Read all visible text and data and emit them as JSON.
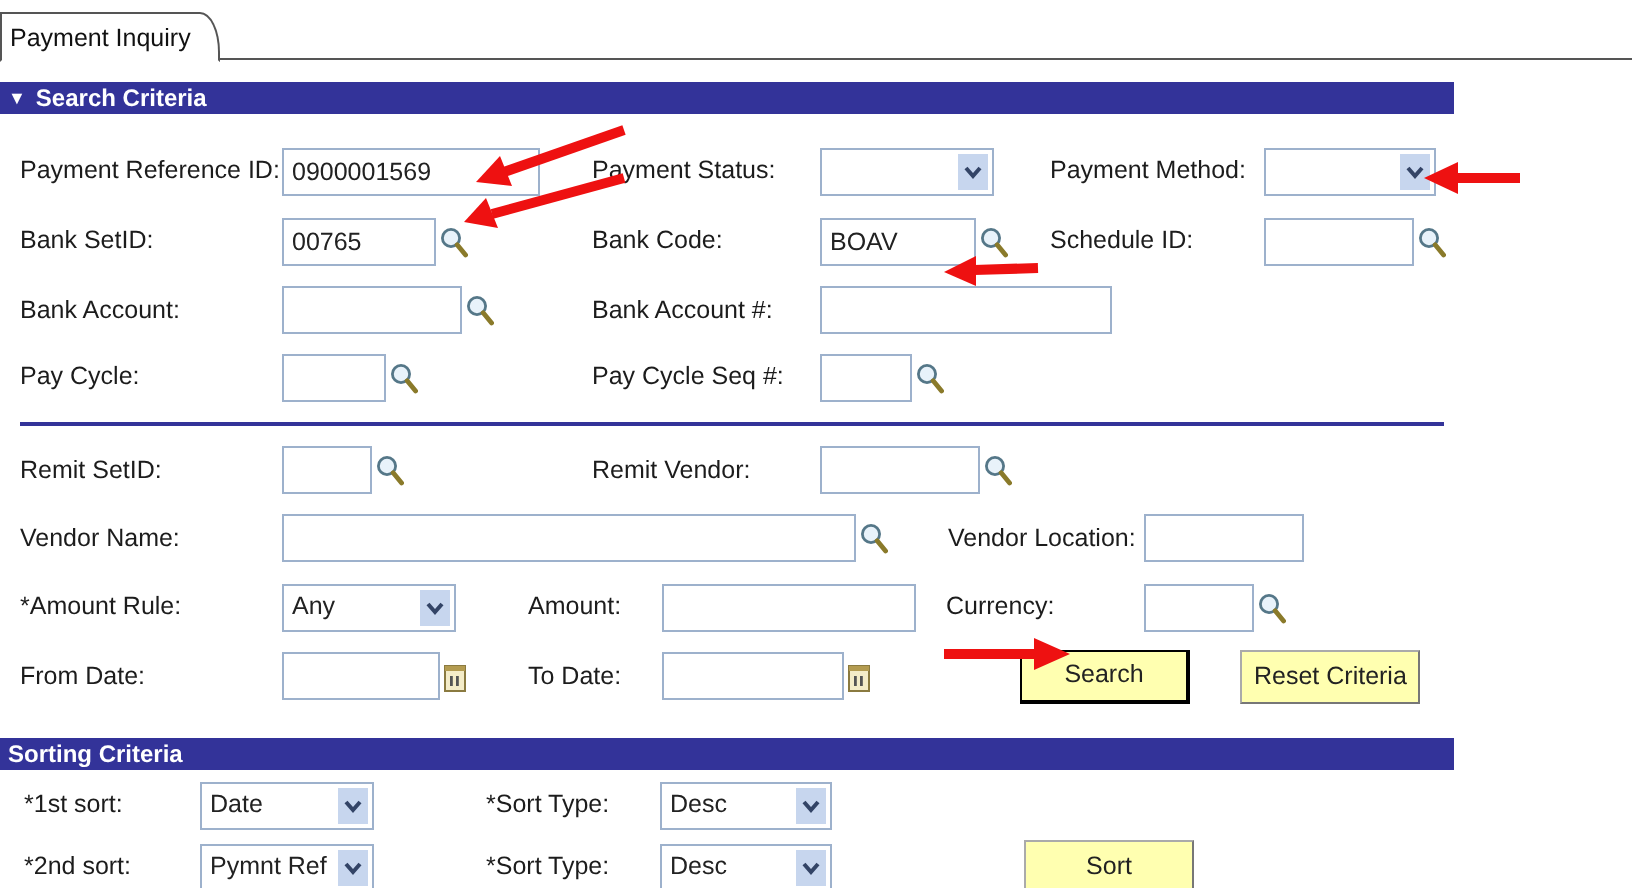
{
  "tab": {
    "label": "Payment Inquiry",
    "selected": true
  },
  "sections": [
    {
      "title": "Search Criteria",
      "icon": "▼",
      "rows": [
        {
          "kind": "fields",
          "items": [
            {
              "kind": "input",
              "label": "Payment Reference ID:",
              "value": "0900001569",
              "lookup": false,
              "calendar": false
            },
            {
              "kind": "select",
              "label": "Payment Status:"
            },
            {
              "kind": "select",
              "label": "Payment Method:"
            }
          ]
        },
        {
          "kind": "fields",
          "items": [
            {
              "kind": "input",
              "label": "Bank SetID:",
              "value": "00765",
              "lookup": true,
              "calendar": false
            },
            {
              "kind": "input",
              "label": "Bank Code:",
              "value": "BOAV",
              "lookup": true,
              "calendar": false
            },
            {
              "kind": "input",
              "label": "Schedule ID:",
              "lookup": true,
              "calendar": false
            }
          ]
        },
        {
          "kind": "fields",
          "items": [
            {
              "kind": "input",
              "label": "Bank Account:",
              "lookup": true,
              "calendar": false
            },
            {
              "kind": "input",
              "label": "Bank Account #:",
              "lookup": false,
              "calendar": false
            }
          ]
        },
        {
          "kind": "fields",
          "items": [
            {
              "kind": "input",
              "label": "Pay Cycle:",
              "lookup": true,
              "calendar": false
            },
            {
              "kind": "input",
              "label": "Pay Cycle Seq #:",
              "lookup": true,
              "calendar": false
            }
          ]
        },
        {
          "kind": "divider"
        },
        {
          "kind": "fields",
          "items": [
            {
              "kind": "input",
              "label": "Remit SetID:",
              "lookup": true,
              "calendar": false
            },
            {
              "kind": "input",
              "label": "Remit Vendor:",
              "lookup": true,
              "calendar": false
            }
          ]
        },
        {
          "kind": "fields",
          "items": [
            {
              "kind": "input",
              "label": "Vendor Name:",
              "lookup": true,
              "calendar": false
            },
            {
              "kind": "input",
              "label": "Vendor Location:",
              "lookup": false,
              "calendar": false
            }
          ]
        },
        {
          "kind": "fields",
          "items": [
            {
              "kind": "select",
              "label": "*Amount Rule:",
              "value": "Any"
            },
            {
              "kind": "input",
              "label": "Amount:",
              "lookup": false,
              "calendar": false
            },
            {
              "kind": "input",
              "label": "Currency:",
              "lookup": true,
              "calendar": false
            }
          ]
        },
        {
          "kind": "fields",
          "items": [
            {
              "kind": "input",
              "label": "From Date:",
              "lookup": false,
              "calendar": true
            },
            {
              "kind": "input",
              "label": "To Date:",
              "lookup": false,
              "calendar": true
            },
            {
              "kind": "button",
              "label": "Search",
              "default": true
            },
            {
              "kind": "button",
              "label": "Reset Criteria",
              "default": false
            }
          ]
        }
      ]
    },
    {
      "title": "Sorting Criteria",
      "rows": [
        {
          "kind": "fields",
          "items": [
            {
              "kind": "select",
              "label": "*1st sort:",
              "value": "Date"
            },
            {
              "kind": "select",
              "label": "*Sort Type:",
              "value": "Desc"
            }
          ]
        },
        {
          "kind": "fields",
          "items": [
            {
              "kind": "select",
              "label": "*2nd sort:",
              "value": "Pymnt Ref"
            },
            {
              "kind": "select",
              "label": "*Sort Type:",
              "value": "Desc"
            },
            {
              "kind": "button",
              "label": "Sort",
              "default": false
            }
          ]
        }
      ]
    }
  ]
}
